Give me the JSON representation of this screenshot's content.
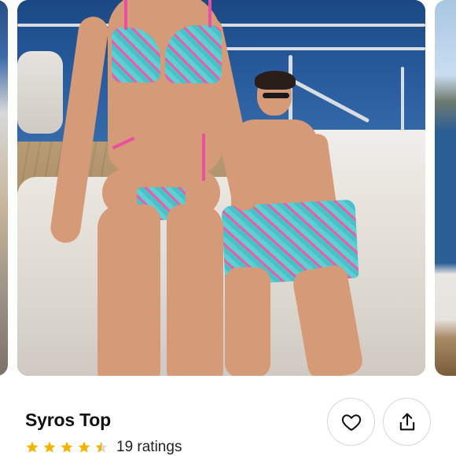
{
  "product": {
    "title": "Syros Top",
    "rating_value": 4.5,
    "rating_max": 5,
    "rating_text": "19 ratings"
  },
  "actions": {
    "favorite_icon": "heart-icon",
    "share_icon": "share-upload-icon"
  },
  "carousel": {
    "image_subject": "photo"
  },
  "colors": {
    "star_color": "#f4b400",
    "icon_stroke": "#111111"
  }
}
